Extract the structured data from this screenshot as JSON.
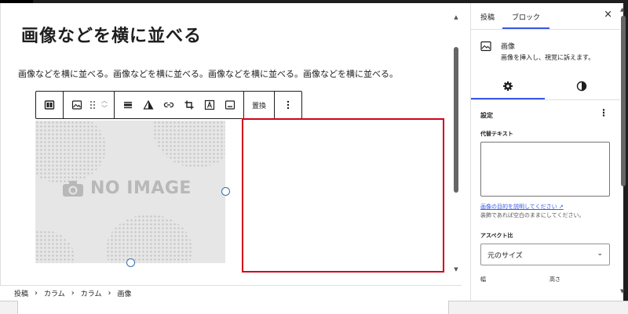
{
  "post": {
    "title": "画像などを横に並べる",
    "paragraph": "画像などを横に並べる。画像などを横に並べる。画像などを横に並べる。画像などを横に並べる。"
  },
  "toolbar": {
    "replace_label": "置換"
  },
  "placeholder_image": {
    "text": "NO IMAGE"
  },
  "breadcrumb": {
    "items": [
      "投稿",
      "カラム",
      "カラム",
      "画像"
    ],
    "separator": "›"
  },
  "sidebar": {
    "tabs": [
      "投稿",
      "ブロック"
    ],
    "active_tab": "ブロック",
    "close_symbol": "×",
    "block_card": {
      "title": "画像",
      "description": "画像を挿入し、視覚に訴えます。"
    },
    "panel_title": "設定",
    "alt_text": {
      "label": "代替テキスト",
      "value": "",
      "link": "画像の目的を説明してください",
      "link_suffix": "↗",
      "help": "装飾であれば空白のままにしてください。"
    },
    "aspect_ratio": {
      "label": "アスペクト比",
      "selected": "元のサイズ"
    },
    "width_label": "幅",
    "height_label": "高さ"
  },
  "colors": {
    "accent": "#3858e9",
    "selection_outline": "#d0021b",
    "handle": "#3171b3"
  }
}
